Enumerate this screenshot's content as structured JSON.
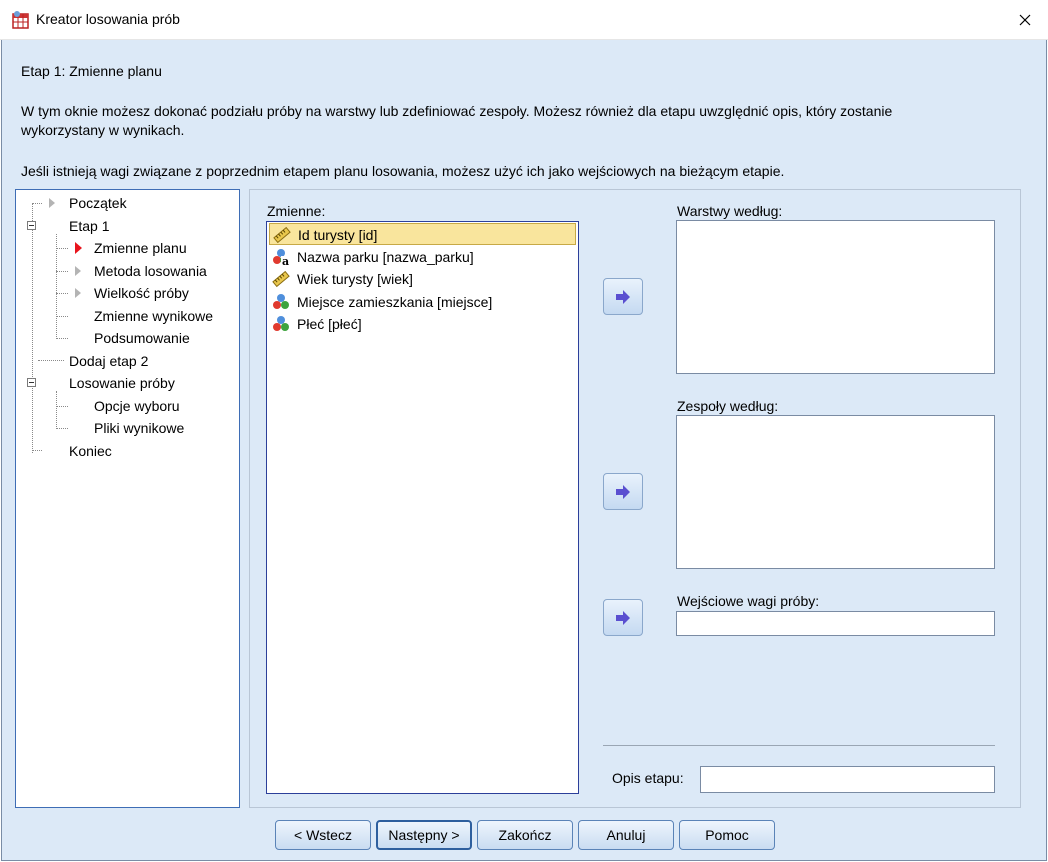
{
  "window": {
    "title": "Kreator losowania prób"
  },
  "step_heading": "Etap 1: Zmienne planu",
  "description_line1": "W tym oknie możesz dokonać podziału próby na warstwy lub zdefiniować zespoły. Możesz również dla etapu uwzględnić opis, który zostanie",
  "description_line1b": "wykorzystany w wynikach.",
  "description_line2": "Jeśli istnieją wagi związane z poprzednim etapem planu losowania, możesz użyć ich jako wejściowych na bieżącym etapie.",
  "tree": {
    "items": [
      {
        "label": "Początek"
      },
      {
        "label": "Etap 1"
      },
      {
        "label": "Zmienne planu"
      },
      {
        "label": "Metoda losowania"
      },
      {
        "label": "Wielkość próby"
      },
      {
        "label": "Zmienne wynikowe"
      },
      {
        "label": "Podsumowanie"
      },
      {
        "label": "Dodaj etap 2"
      },
      {
        "label": "Losowanie próby"
      },
      {
        "label": "Opcje wyboru"
      },
      {
        "label": "Pliki wynikowe"
      },
      {
        "label": "Koniec"
      }
    ]
  },
  "variables": {
    "label": "Zmienne:",
    "items": [
      {
        "label": "Id turysty [id]",
        "icon": "ruler-scale-icon"
      },
      {
        "label": "Nazwa parku [nazwa_parku]",
        "icon": "nominal-string-icon"
      },
      {
        "label": "Wiek turysty [wiek]",
        "icon": "ruler-scale-icon"
      },
      {
        "label": "Miejsce zamieszkania [miejsce]",
        "icon": "nominal-icon"
      },
      {
        "label": "Płeć [płeć]",
        "icon": "nominal-icon"
      }
    ]
  },
  "strata": {
    "label": "Warstwy według:"
  },
  "clusters": {
    "label": "Zespoły według:"
  },
  "input_weights": {
    "label": "Wejściowe wagi próby:",
    "value": ""
  },
  "stage_label": {
    "label": "Opis etapu:",
    "value": ""
  },
  "buttons": {
    "back": "< Wstecz",
    "next": "Następny >",
    "finish": "Zakończ",
    "cancel": "Anuluj",
    "help": "Pomoc"
  },
  "colors": {
    "accent_border": "#2c3f9a",
    "selection": "#f9e59d",
    "dialog_bg": "#dce9f7",
    "current_step_marker": "#e8141d"
  }
}
